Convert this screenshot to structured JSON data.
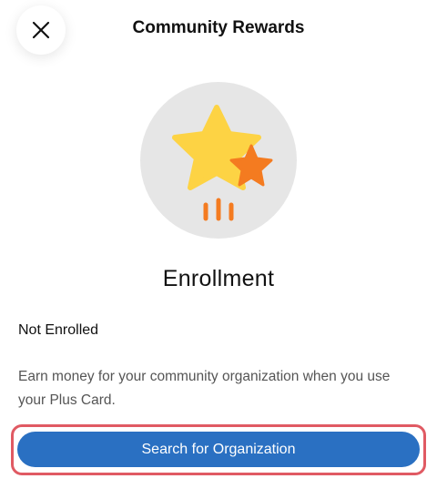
{
  "header": {
    "title": "Community Rewards",
    "close_icon": "close-icon"
  },
  "hero": {
    "icon": "stars-icon",
    "colors": {
      "circle": "#e6e6e6",
      "big_star": "#fdd344",
      "small_star": "#f47b20"
    }
  },
  "section": {
    "title": "Enrollment",
    "status": "Not Enrolled",
    "description": "Earn money for your community organization when you use your Plus Card."
  },
  "action": {
    "search_label": "Search for Organization",
    "accent": "#2a70c2",
    "highlight": "#e05a63"
  }
}
